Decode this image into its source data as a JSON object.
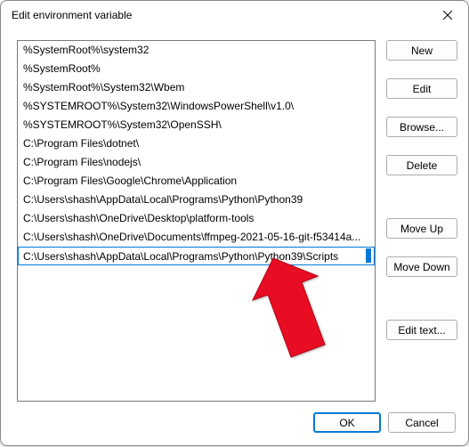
{
  "title": "Edit environment variable",
  "paths": [
    "%SystemRoot%\\system32",
    "%SystemRoot%",
    "%SystemRoot%\\System32\\Wbem",
    "%SYSTEMROOT%\\System32\\WindowsPowerShell\\v1.0\\",
    "%SYSTEMROOT%\\System32\\OpenSSH\\",
    "C:\\Program Files\\dotnet\\",
    "C:\\Program Files\\nodejs\\",
    "C:\\Program Files\\Google\\Chrome\\Application",
    "C:\\Users\\shash\\AppData\\Local\\Programs\\Python\\Python39",
    "C:\\Users\\shash\\OneDrive\\Desktop\\platform-tools",
    "C:\\Users\\shash\\OneDrive\\Documents\\ffmpeg-2021-05-16-git-f53414a..."
  ],
  "editing_value": "C:\\Users\\shash\\AppData\\Local\\Programs\\Python\\Python39\\Scripts",
  "buttons": {
    "new": "New",
    "edit": "Edit",
    "browse": "Browse...",
    "delete": "Delete",
    "move_up": "Move Up",
    "move_down": "Move Down",
    "edit_text": "Edit text...",
    "ok": "OK",
    "cancel": "Cancel"
  }
}
